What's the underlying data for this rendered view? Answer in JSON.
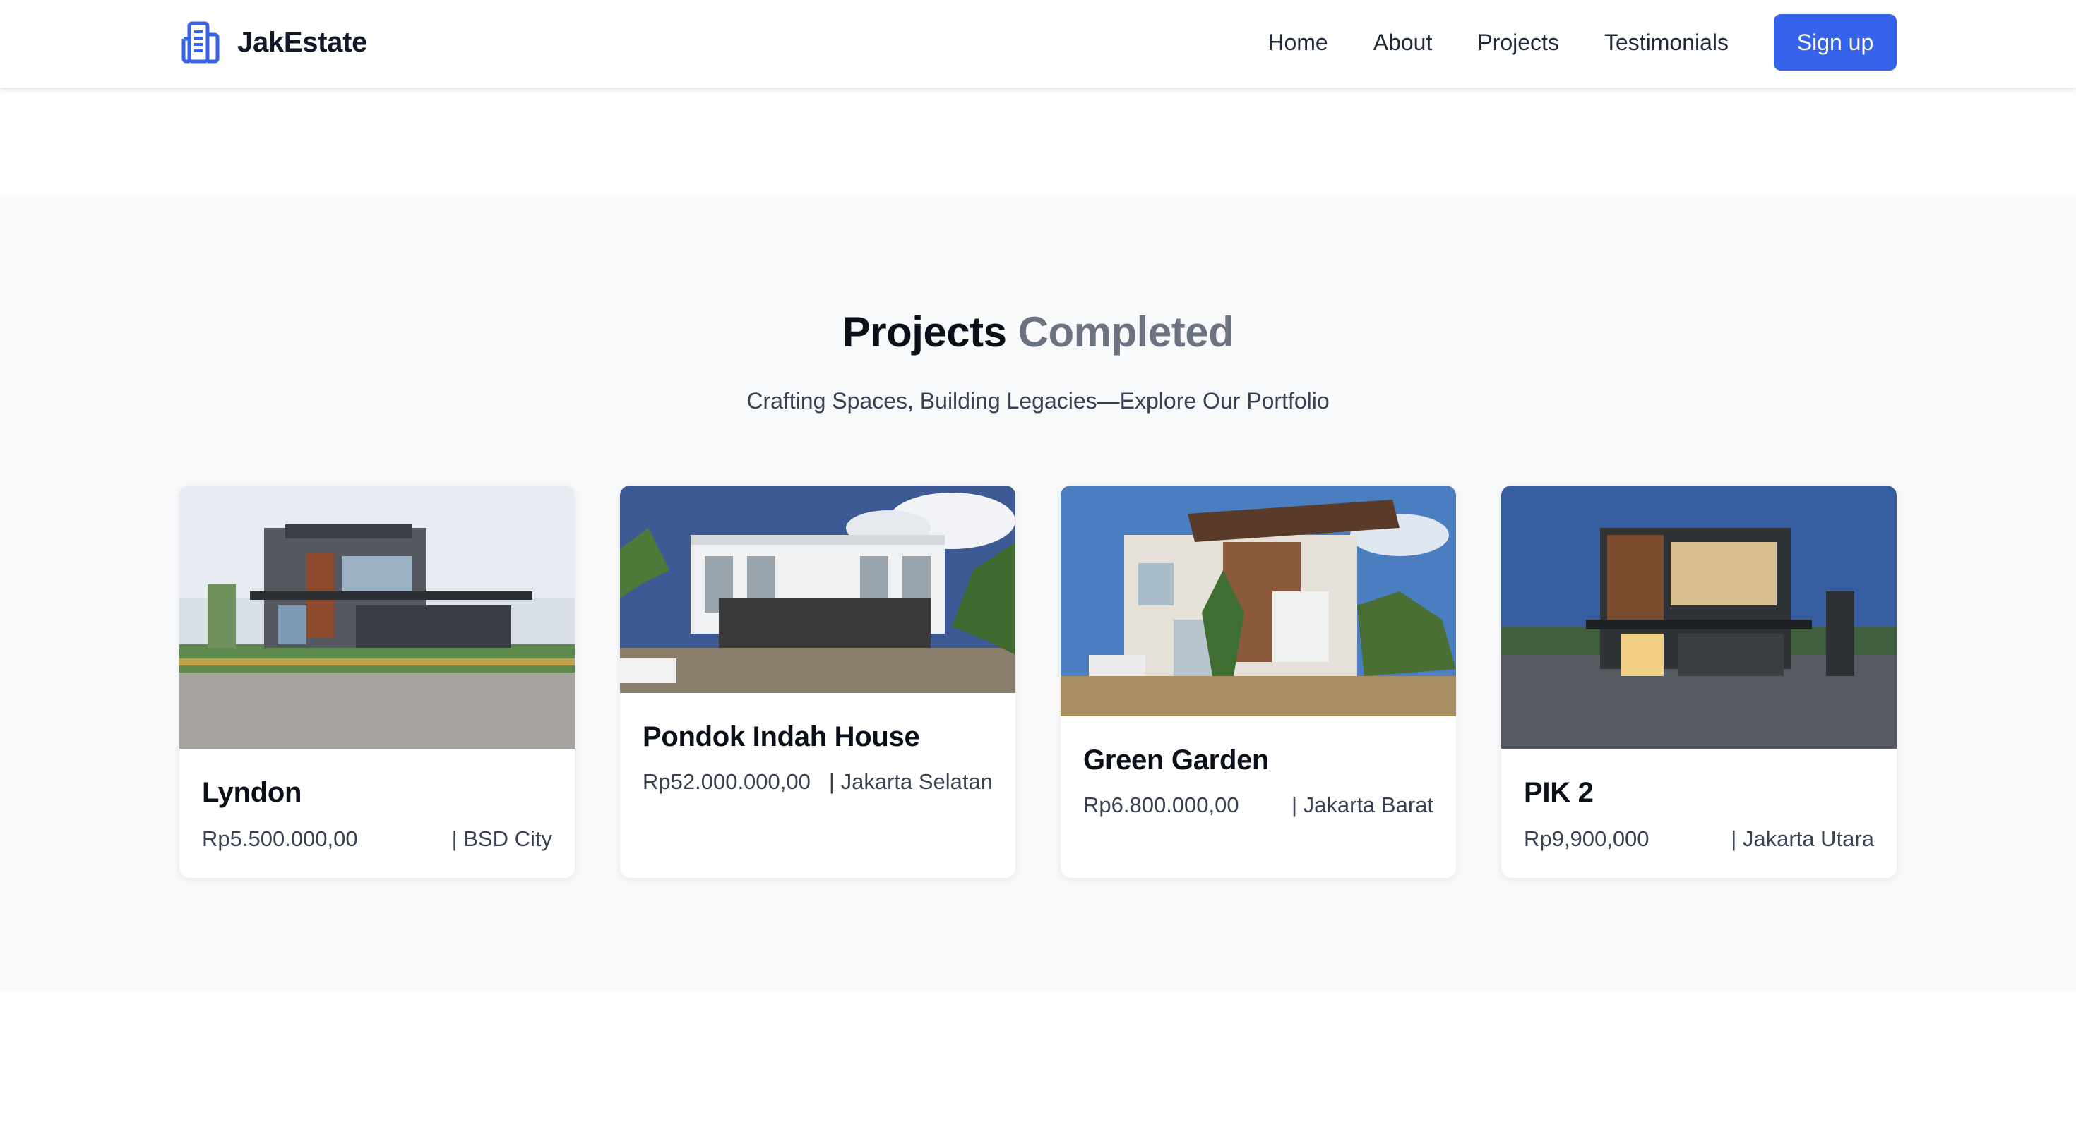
{
  "brand": {
    "name": "JakEstate",
    "icon": "building-icon"
  },
  "nav": {
    "links": [
      "Home",
      "About",
      "Projects",
      "Testimonials"
    ],
    "signup_label": "Sign up"
  },
  "projects": {
    "title_primary": "Projects",
    "title_secondary": "Completed",
    "subtitle": "Crafting Spaces, Building Legacies—Explore Our Portfolio",
    "cards": [
      {
        "name": "Lyndon",
        "price": "Rp5.500.000,00",
        "location": "| BSD City"
      },
      {
        "name": "Pondok Indah House",
        "price": "Rp52.000.000,00",
        "location": "| Jakarta Selatan"
      },
      {
        "name": "Green Garden",
        "price": "Rp6.800.000,00",
        "location": "| Jakarta Barat"
      },
      {
        "name": "PIK 2",
        "price": "Rp9,900,000",
        "location": "| Jakarta Utara"
      }
    ]
  },
  "colors": {
    "accent": "#3563e9",
    "section_bg": "#f8f9fb",
    "title_muted": "#6b7280"
  }
}
